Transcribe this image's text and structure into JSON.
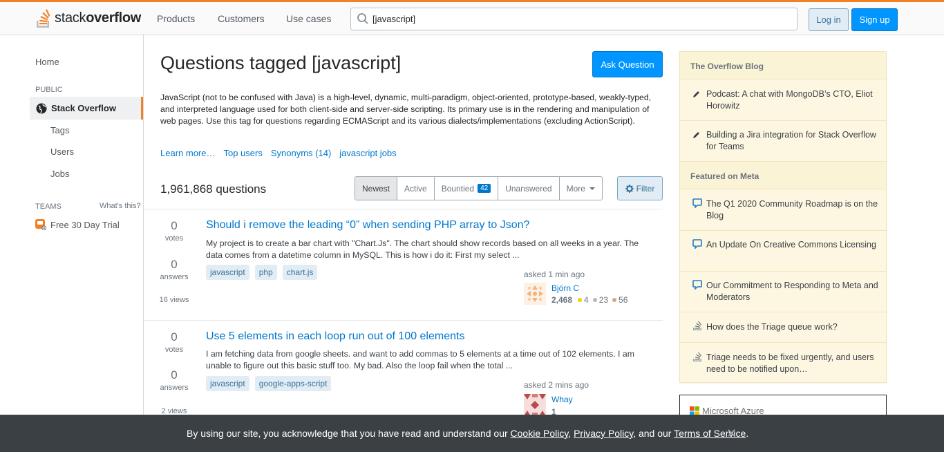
{
  "header": {
    "logo_light": "stack",
    "logo_bold": "overflow",
    "nav": [
      "Products",
      "Customers",
      "Use cases"
    ],
    "search_value": "[javascript]",
    "login_label": "Log in",
    "signup_label": "Sign up"
  },
  "sidebar": {
    "home": "Home",
    "public_heading": "PUBLIC",
    "active_item": "Stack Overflow",
    "items": [
      "Tags",
      "Users",
      "Jobs"
    ],
    "teams_heading": "TEAMS",
    "whats_this": "What's this?",
    "trial": "Free 30 Day Trial"
  },
  "main": {
    "title": "Questions tagged [javascript]",
    "ask_button": "Ask Question",
    "description": "JavaScript (not to be confused with Java) is a high-level, dynamic, multi-paradigm, object-oriented, prototype-based, weakly-typed, and interpreted language used for both client-side and server-side scripting. Its primary use is in the rendering and manipulation of web pages. Use this tag for questions regarding ECMAScript and its various dialects/implementations (excluding ActionScript).",
    "links": [
      "Learn more…",
      "Top users",
      "Synonyms (14)",
      "javascript jobs"
    ],
    "question_count": "1,961,868 questions",
    "tabs": {
      "newest": "Newest",
      "active": "Active",
      "bountied": "Bountied",
      "bountied_badge": "42",
      "unanswered": "Unanswered",
      "more": "More"
    },
    "filter_label": "Filter"
  },
  "questions": [
    {
      "votes": "0",
      "votes_label": "votes",
      "answers": "0",
      "answers_label": "answers",
      "views": "16 views",
      "title": "Should i remove the leading “0” when sending PHP array to Json?",
      "excerpt": "My project is to create a bar chart with \"Chart.Js\". The chart should show records based on all weeks in a year. The data comes from a datetime column in MySQL. This is how i do it: First my select ...",
      "tags": [
        "javascript",
        "php",
        "chart.js"
      ],
      "asked": "asked 1 min ago",
      "user": "Björn C",
      "rep": "2,468",
      "gold": "4",
      "silver": "23",
      "bronze": "56"
    },
    {
      "votes": "0",
      "votes_label": "votes",
      "answers": "0",
      "answers_label": "answers",
      "views": "2 views",
      "title": "Use 5 elements in each loop run out of 100 elements",
      "excerpt": "I am fetching data from google sheets. and want to add commas to 5 elements at a time out of 102 elements. I am unable to figure out this basic stuff too. My bad. Also the loop fail when the total ...",
      "tags": [
        "javascript",
        "google-apps-script"
      ],
      "asked": "asked 2 mins ago",
      "user": "Whay",
      "rep": "1"
    }
  ],
  "right_sidebar": {
    "blog_heading": "The Overflow Blog",
    "blog_items": [
      "Podcast: A chat with MongoDB’s CTO, Eliot Horowitz",
      "Building a Jira integration for Stack Overflow for Teams"
    ],
    "meta_heading": "Featured on Meta",
    "meta_items": [
      "The Q1 2020 Community Roadmap is on the Blog",
      "An Update On Creative Commons Licensing",
      "Our Commitment to Responding to Meta and Moderators",
      "How does the Triage queue work?",
      "Triage needs to be fixed urgently, and users need to be notified upon…"
    ],
    "ad_text": "Microsoft Azure"
  },
  "cookie": {
    "prefix": "By using our site, you acknowledge that you have read and understand our ",
    "cookie_policy": "Cookie Policy",
    "sep1": ", ",
    "privacy_policy": "Privacy Policy",
    "sep2": ", and our ",
    "terms": "Terms of Service",
    "suffix": ".",
    "close": "✕"
  },
  "colors": {
    "accent": "#f48024",
    "link": "#0077cc",
    "primary_button": "#0095ff",
    "tag_bg": "#e1ecf4",
    "sidebar_bg": "#fdf7e2"
  }
}
